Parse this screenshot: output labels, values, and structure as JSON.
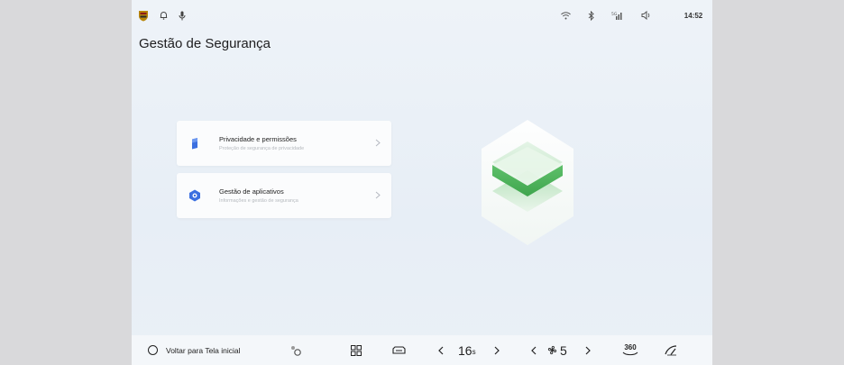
{
  "status_bar": {
    "time": "14:52",
    "icons": [
      "app-logo-icon",
      "bell-icon",
      "microphone-icon",
      "wifi-icon",
      "bluetooth-icon",
      "cellular-signal-icon",
      "volume-icon"
    ]
  },
  "page": {
    "title": "Gestão de Segurança"
  },
  "menu": {
    "items": [
      {
        "title": "Privacidade e permissões",
        "subtitle": "Proteção de segurança de privacidade",
        "icon": "privacy-shield-icon"
      },
      {
        "title": "Gestão de aplicativos",
        "subtitle": "Informações e gestão de segurança",
        "icon": "app-security-icon"
      }
    ]
  },
  "bottom_bar": {
    "home_label": "Voltar para Tela inicial",
    "temperature_value": "16",
    "temperature_suffix": "s",
    "fan_value": "5",
    "view_360_label": "360"
  },
  "colors": {
    "accent_green": "#5cb96a",
    "page_background": "#eaf0f6",
    "card_background": "#fbfcfd"
  }
}
